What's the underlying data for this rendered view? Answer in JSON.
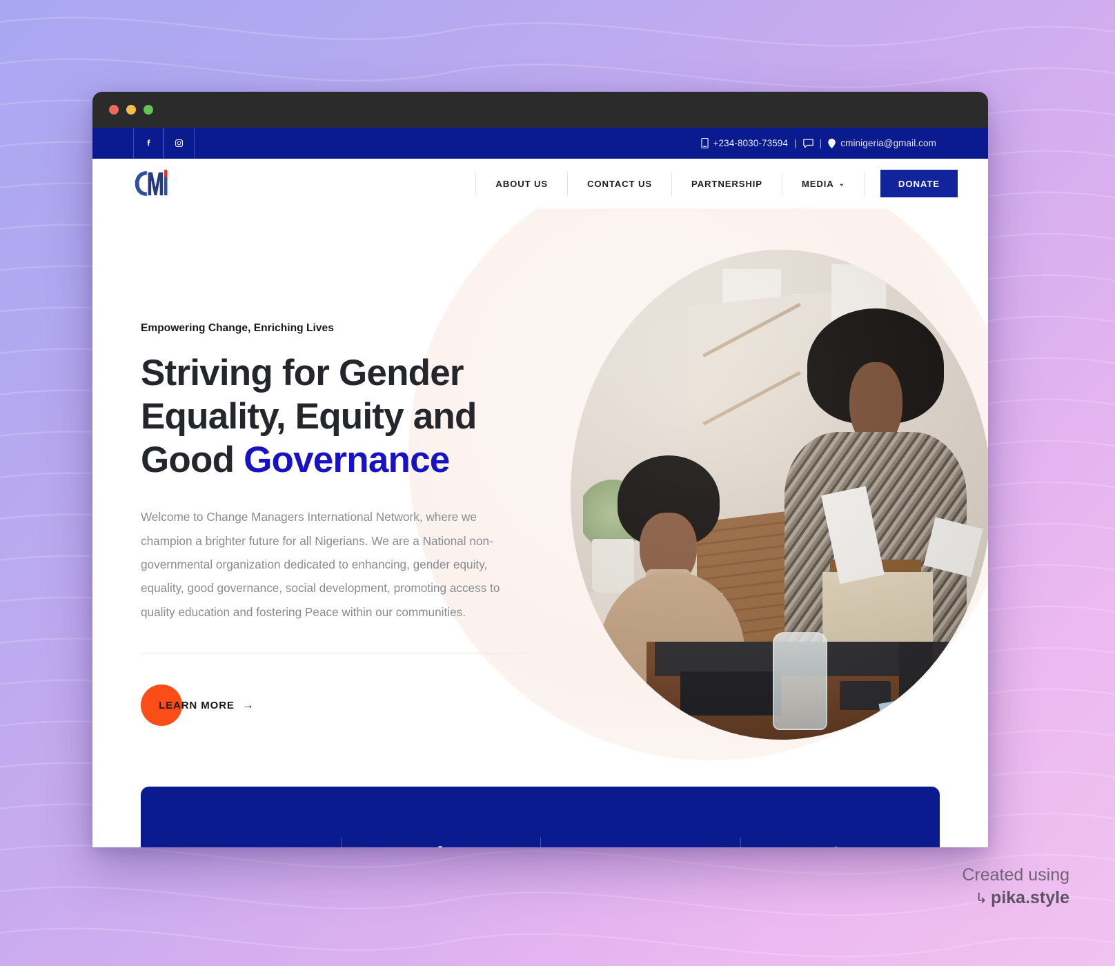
{
  "window": {
    "traffic_lights": [
      "close",
      "minimize",
      "maximize"
    ]
  },
  "topbar": {
    "social": [
      {
        "name": "facebook",
        "label": "Facebook"
      },
      {
        "name": "instagram",
        "label": "Instagram"
      }
    ],
    "phone": "+234-8030-73594",
    "separator": "|",
    "email": "cminigeria@gmail.com",
    "phone_icon": "mobile-phone-icon",
    "chat_icon": "chat-bubble-icon",
    "location_icon": "location-pin-icon",
    "background_color": "#0a1a8f"
  },
  "navbar": {
    "logo_alt": "CMI",
    "items": [
      {
        "label": "ABOUT US",
        "has_caret": false
      },
      {
        "label": "CONTACT US",
        "has_caret": false
      },
      {
        "label": "PARTNERSHIP",
        "has_caret": false
      },
      {
        "label": "MEDIA",
        "has_caret": true,
        "caret": "⌄"
      }
    ],
    "donate_label": "DONATE",
    "donate_color": "#11249b"
  },
  "hero": {
    "eyebrow": "Empowering Change, Enriching Lives",
    "headline_part1": "Striving for Gender Equality, Equity and Good ",
    "headline_accent": "Governance",
    "accent_color": "#1712c4",
    "paragraph": "Welcome to Change Managers International Network, where we champion a brighter future for all Nigerians. We are a National non-governmental organization dedicated to enhancing, gender equity, equality, good governance, social development, promoting access to quality education and fostering Peace within our communities.",
    "cta_label": "LEARN MORE",
    "cta_arrow": "→",
    "cta_circle_color": "#fb4d18",
    "photo_alt": "Two women collaborating at an office meeting table"
  },
  "stats_bar": {
    "background_color": "#0a1a8f",
    "items": [
      {
        "icon": "briefcase-icon"
      },
      {
        "icon": "people-group-icon"
      },
      {
        "icon": "open-book-icon"
      },
      {
        "icon": "users-pair-icon"
      }
    ]
  },
  "watermark": {
    "line1": "Created using",
    "arrow": "↳",
    "line2": "pika.style"
  }
}
